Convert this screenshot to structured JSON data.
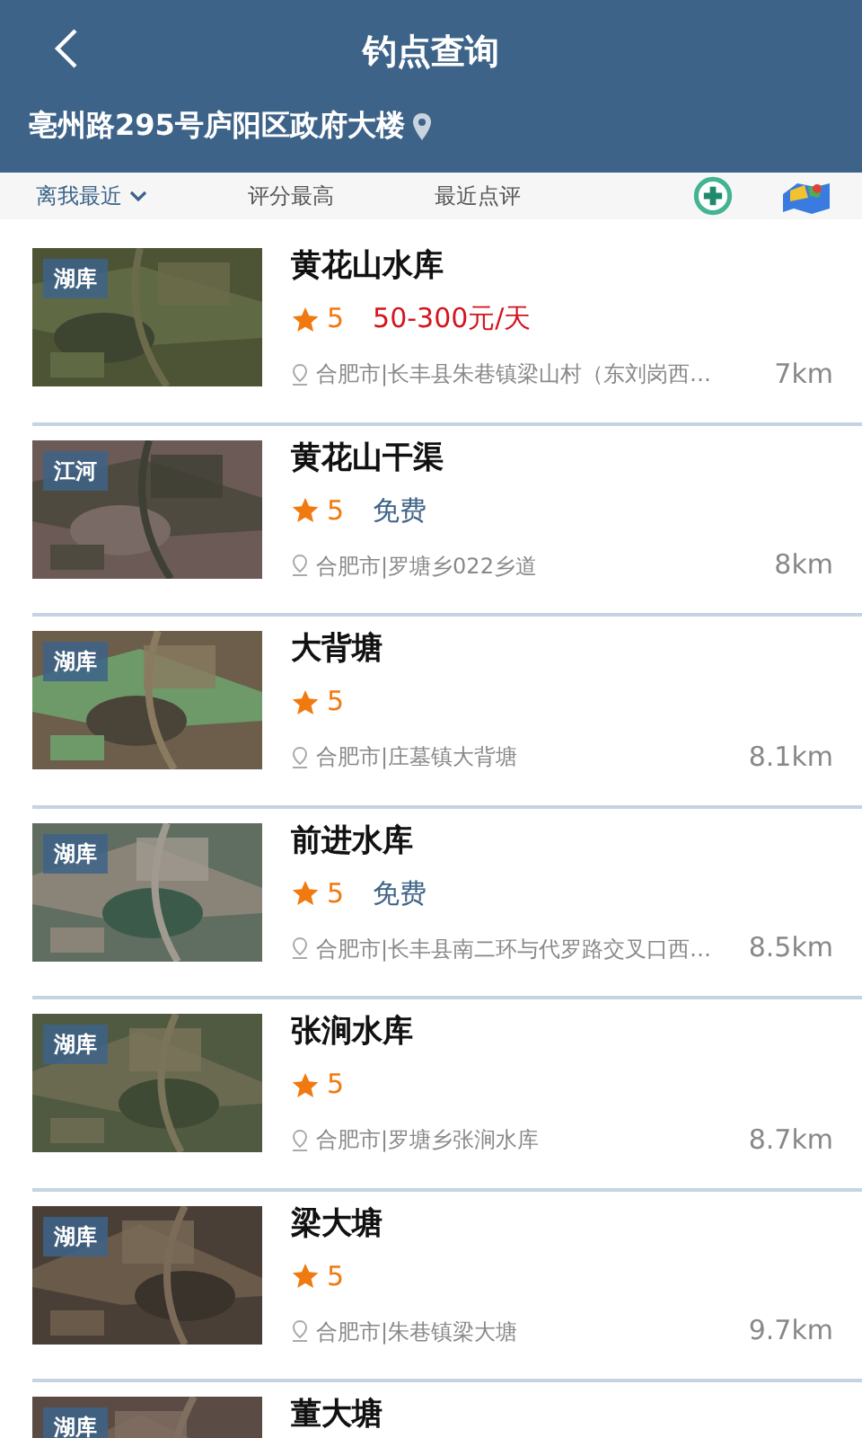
{
  "header": {
    "title": "钓点查询",
    "location": "亳州路295号庐阳区政府大楼"
  },
  "filters": [
    {
      "label": "离我最近",
      "selected": true,
      "dropdown": true
    },
    {
      "label": "评分最高",
      "selected": false,
      "dropdown": false
    },
    {
      "label": "最近点评",
      "selected": false,
      "dropdown": false
    }
  ],
  "spots": [
    {
      "tag": "湖库",
      "name": "黄花山水库",
      "rating": "5",
      "price": "50-300元/天",
      "price_free": false,
      "address": "合肥市|长丰县朱巷镇梁山村（东刘岗西…",
      "distance": "7km"
    },
    {
      "tag": "江河",
      "name": "黄花山干渠",
      "rating": "5",
      "price": "免费",
      "price_free": true,
      "address": "合肥市|罗塘乡022乡道",
      "distance": "8km"
    },
    {
      "tag": "湖库",
      "name": "大背塘",
      "rating": "5",
      "address": "合肥市|庄墓镇大背塘",
      "distance": "8.1km"
    },
    {
      "tag": "湖库",
      "name": "前进水库",
      "rating": "5",
      "price": "免费",
      "price_free": true,
      "address": "合肥市|长丰县南二环与代罗路交叉口西…",
      "distance": "8.5km"
    },
    {
      "tag": "湖库",
      "name": "张涧水库",
      "rating": "5",
      "address": "合肥市|罗塘乡张涧水库",
      "distance": "8.7km"
    },
    {
      "tag": "湖库",
      "name": "梁大塘",
      "rating": "5",
      "address": "合肥市|朱巷镇梁大塘",
      "distance": "9.7km"
    },
    {
      "tag": "湖库",
      "name": "董大塘"
    }
  ]
}
